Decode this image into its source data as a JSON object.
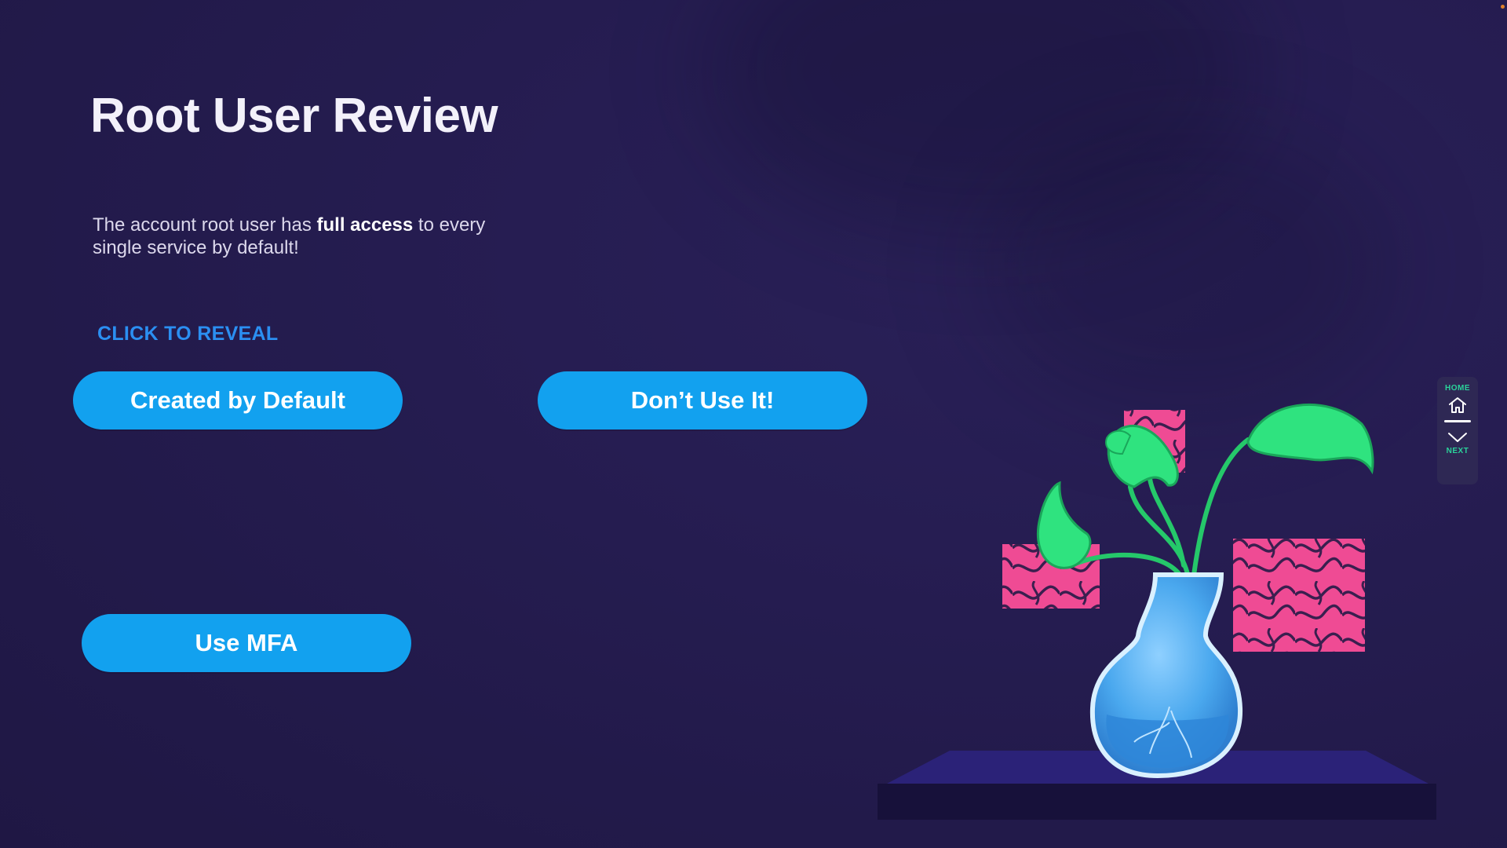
{
  "page": {
    "title": "Root User Review",
    "subtitle": {
      "before": "The account root user has ",
      "bold": "full access",
      "after": " to every single service by default!"
    },
    "reveal_label": "CLICK TO REVEAL"
  },
  "reveal_buttons": {
    "created": "Created by Default",
    "dont_use": "Don’t Use It!",
    "mfa": "Use MFA"
  },
  "nav": {
    "home_label": "HOME",
    "home_icon": "home-icon",
    "next_icon": "chevron-down-icon",
    "next_label": "NEXT"
  },
  "colors": {
    "background": "#241b4d",
    "button": "#12a1ef",
    "reveal_label": "#2b8ff2",
    "nav_accent": "#2bd39a",
    "leaf": "#2fe37f",
    "tile_pink": "#ef4b94",
    "vase": "#4aa8ee"
  }
}
